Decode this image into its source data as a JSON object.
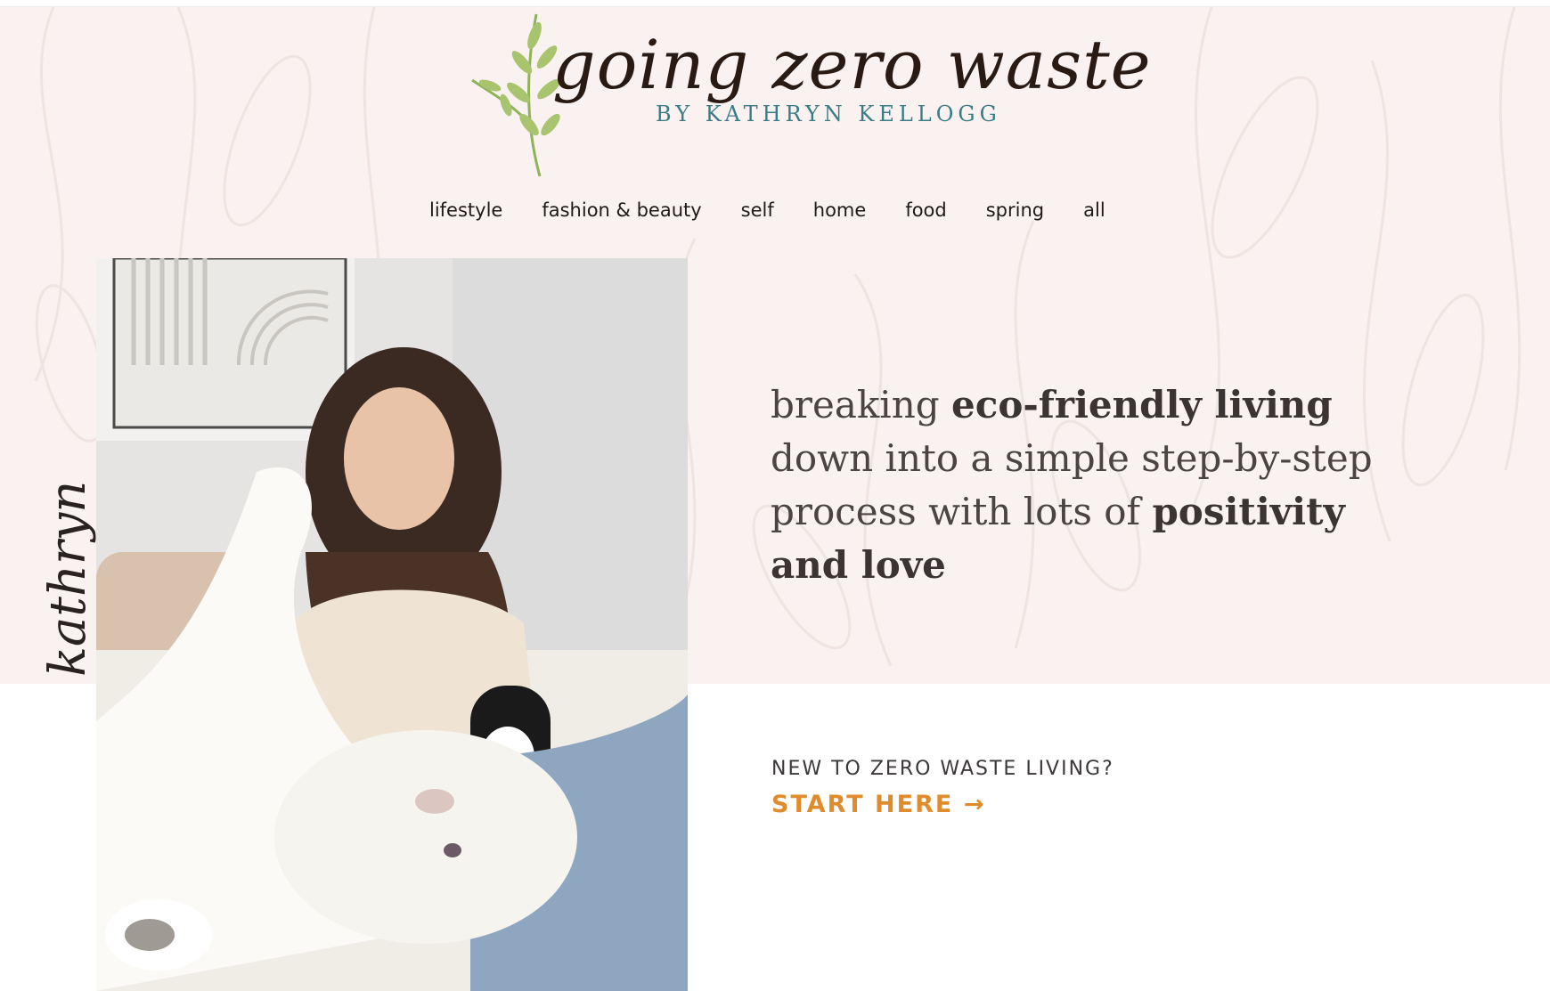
{
  "header": {
    "logo_script": "going zero waste",
    "logo_byline": "BY KATHRYN KELLOGG"
  },
  "nav": {
    "items": [
      {
        "label": "lifestyle"
      },
      {
        "label": "fashion & beauty"
      },
      {
        "label": "self"
      },
      {
        "label": "home"
      },
      {
        "label": "food"
      },
      {
        "label": "spring"
      },
      {
        "label": "all"
      }
    ]
  },
  "hero": {
    "signature": "kathryn",
    "tagline": {
      "part1": "breaking ",
      "bold1": "eco-friendly living",
      "part2": " down into a simple step-by-step process with lots of ",
      "bold2": "positivity and love"
    }
  },
  "cta": {
    "prompt": "NEW TO ZERO WASTE LIVING?",
    "link_label": "START HERE →"
  },
  "colors": {
    "hero_background": "#f9f2f0",
    "accent_orange": "#e08c2c",
    "logo_teal": "#3a7c86",
    "leaf_green": "#8fb35a"
  }
}
